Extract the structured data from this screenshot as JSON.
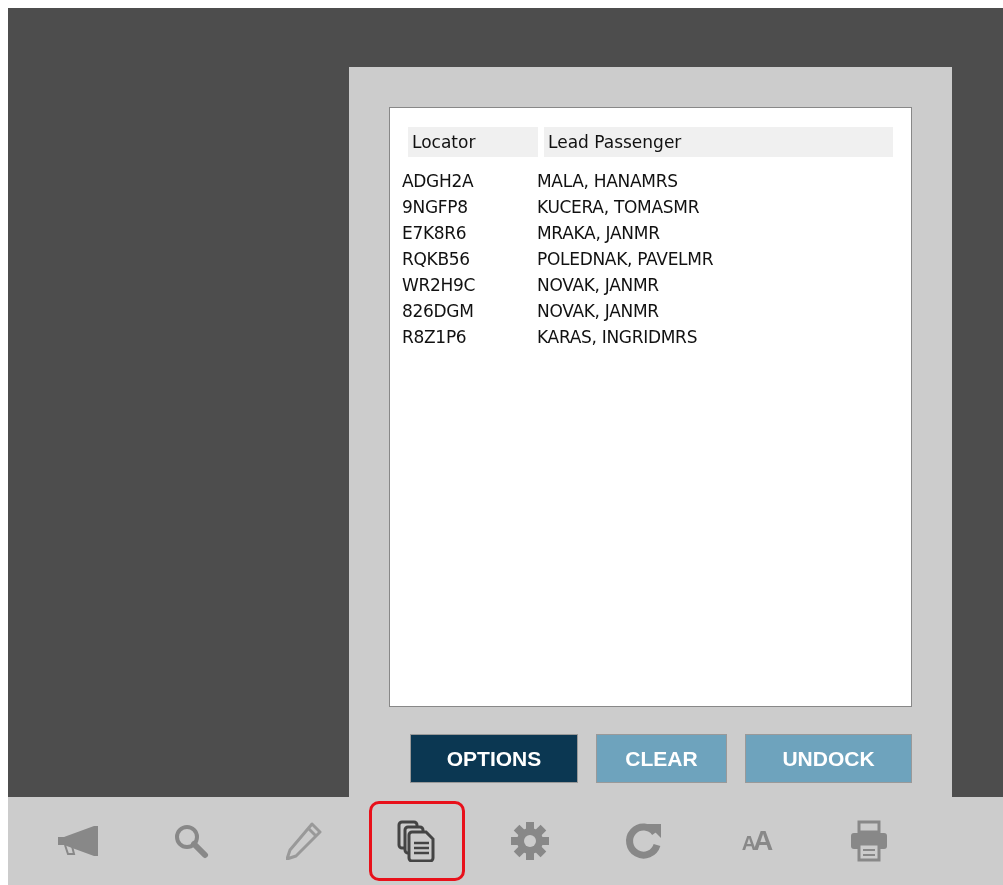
{
  "passenger_list": {
    "columns": [
      "Locator",
      "Lead Passenger"
    ],
    "rows": [
      [
        "ADGH2A",
        "MALA, HANAMRS"
      ],
      [
        "9NGFP8",
        "KUCERA, TOMASMR"
      ],
      [
        "E7K8R6",
        "MRAKA, JANMR"
      ],
      [
        "RQKB56",
        "POLEDNAK, PAVELMR"
      ],
      [
        "WR2H9C",
        "NOVAK, JANMR"
      ],
      [
        "826DGM",
        "NOVAK, JANMR"
      ],
      [
        "R8Z1P6",
        "KARAS, INGRIDMRS"
      ]
    ]
  },
  "buttons": [
    {
      "label": "OPTIONS",
      "kind": "primary"
    },
    {
      "label": "CLEAR",
      "kind": "secondary"
    },
    {
      "label": "UNDOCK",
      "kind": "secondary"
    }
  ],
  "toolbar": [
    {
      "kind": "megaphone",
      "selected": false
    },
    {
      "kind": "search",
      "selected": false
    },
    {
      "kind": "pencil",
      "selected": false
    },
    {
      "kind": "copy",
      "selected": true
    },
    {
      "kind": "gear",
      "selected": false
    },
    {
      "kind": "refresh",
      "selected": false
    },
    {
      "kind": "textsize",
      "label": "AA",
      "selected": false
    },
    {
      "kind": "printer",
      "selected": false
    }
  ]
}
